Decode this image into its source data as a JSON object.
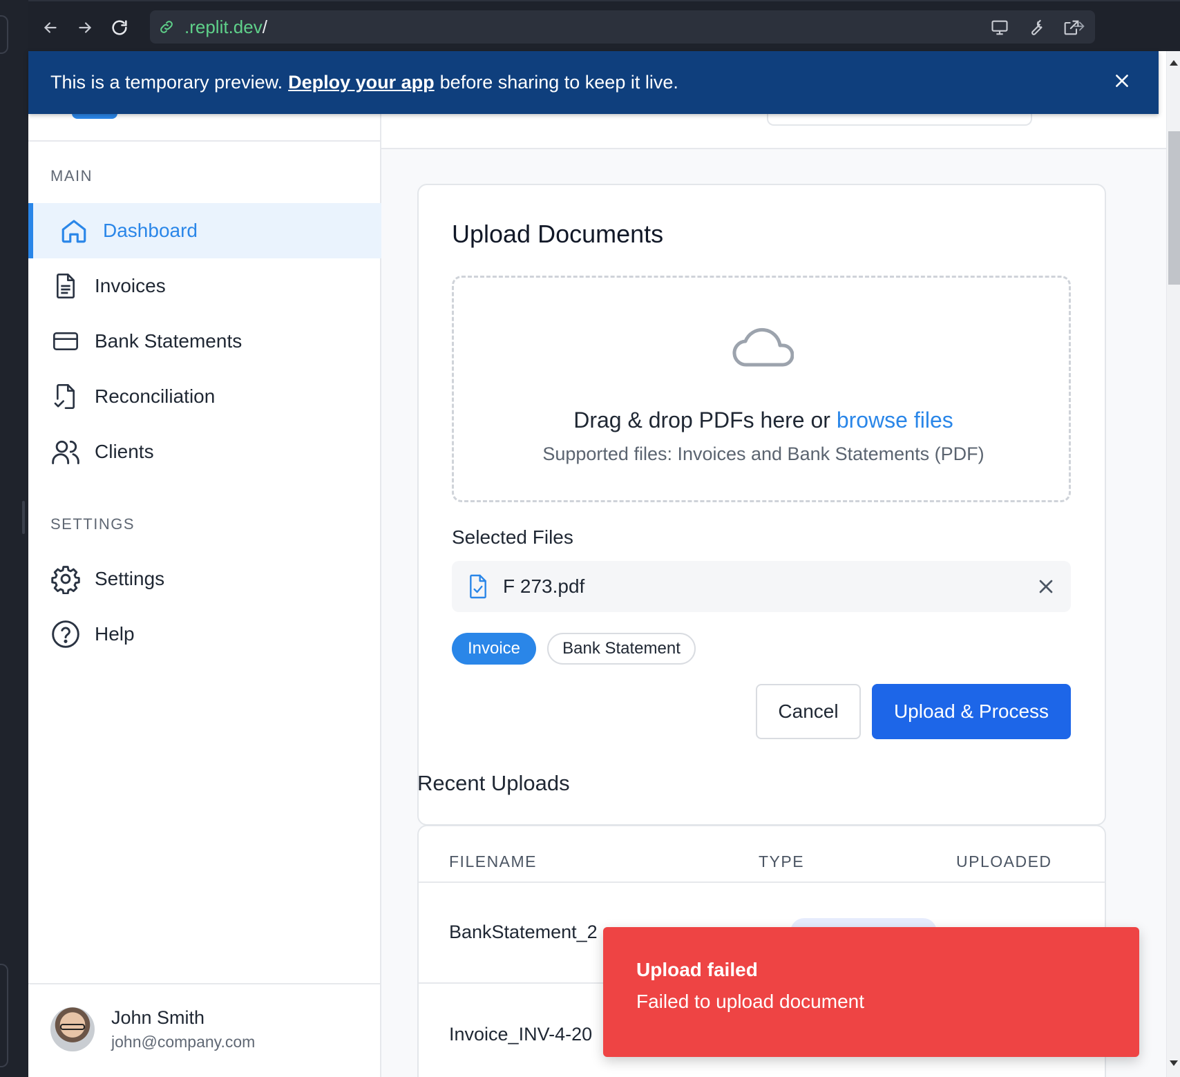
{
  "browser": {
    "url_host": ".replit.dev",
    "url_path": "/"
  },
  "banner": {
    "text_before": "This is a temporary preview.",
    "link": "Deploy your app",
    "text_after": "before sharing to keep it live."
  },
  "sidebar": {
    "main_label": "MAIN",
    "items": [
      {
        "label": "Dashboard",
        "icon": "home-icon",
        "active": true
      },
      {
        "label": "Invoices",
        "icon": "document-icon"
      },
      {
        "label": "Bank Statements",
        "icon": "credit-card-icon"
      },
      {
        "label": "Reconciliation",
        "icon": "document-check-icon"
      },
      {
        "label": "Clients",
        "icon": "users-icon"
      }
    ],
    "settings_label": "SETTINGS",
    "settings_items": [
      {
        "label": "Settings",
        "icon": "gear-icon"
      },
      {
        "label": "Help",
        "icon": "help-circle-icon"
      }
    ],
    "user": {
      "name": "John Smith",
      "email": "john@company.com"
    }
  },
  "upload": {
    "title": "Upload Documents",
    "drop_text": "Drag & drop PDFs here or",
    "browse_link": "browse files",
    "supported": "Supported files: Invoices and Bank Statements (PDF)",
    "selected_label": "Selected Files",
    "file_name": "F 273.pdf",
    "types": [
      "Invoice",
      "Bank Statement"
    ],
    "selected_type": "Invoice",
    "cancel": "Cancel",
    "submit": "Upload & Process"
  },
  "recent": {
    "title": "Recent Uploads",
    "columns": [
      "FILENAME",
      "TYPE",
      "UPLOADED"
    ],
    "rows": [
      {
        "filename": "BankStatement_2"
      },
      {
        "filename": "Invoice_INV-4-20"
      }
    ]
  },
  "toast": {
    "title": "Upload failed",
    "message": "Failed to upload document",
    "color": "#ee4444"
  },
  "colors": {
    "accent": "#2a86e8",
    "primary_button": "#1d66e8",
    "banner": "#0f3f7d"
  }
}
